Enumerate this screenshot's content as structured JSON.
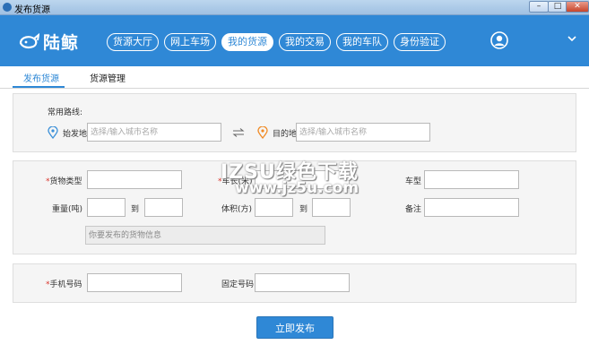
{
  "window": {
    "title": "发布货源"
  },
  "header": {
    "logo_text": "陆鲸",
    "nav": [
      "货源大厅",
      "网上车场",
      "我的货源",
      "我的交易",
      "我的车队",
      "身份验证"
    ],
    "active_nav": 2
  },
  "tabs": [
    "发布货源",
    "货源管理"
  ],
  "route": {
    "label": "常用路线:",
    "origin_label": "始发地",
    "origin_placeholder": "选择/输入城市名称",
    "dest_label": "目的地",
    "dest_placeholder": "选择/输入城市名称"
  },
  "cargo": {
    "cargo_type_label": "货物类型",
    "car_length_label": "车长(米)",
    "car_type_label": "车型",
    "weight_label": "重量(吨)",
    "to_label": "到",
    "volume_label": "体积(方)",
    "remark_label": "备注",
    "info_placeholder": "你要发布的货物信息"
  },
  "contact": {
    "mobile_label": "手机号码",
    "phone_label": "固定号码"
  },
  "submit_label": "立即发布",
  "required_mark": "*",
  "watermark": {
    "line1": "IZSU绿色下载",
    "line2": "www.jz5u.com"
  },
  "colors": {
    "brand": "#2f88d6",
    "origin_pin": "#3a8fd8",
    "dest_pin": "#f08a24",
    "required": "#d9342b"
  }
}
